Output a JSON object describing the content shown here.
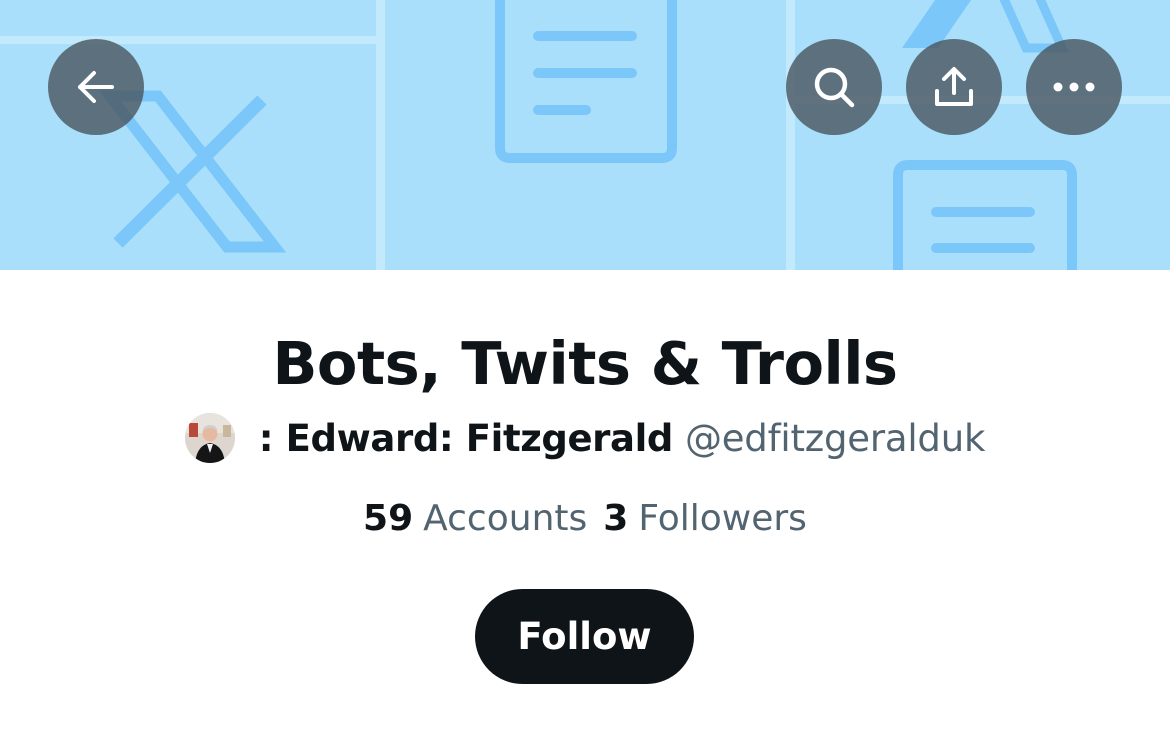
{
  "header": {
    "back_icon": "arrow-left-icon",
    "search_icon": "search-icon",
    "share_icon": "share-upload-icon",
    "more_icon": "more-horizontal-icon"
  },
  "banner": {
    "background_color": "#a9dffa",
    "accent_color": "#7cc7f9",
    "icons": [
      "x-logo-icon",
      "document-icon"
    ]
  },
  "list": {
    "title": "Bots, Twits & Trolls",
    "owner_name": ": Edward: Fitzgerald",
    "owner_handle": "@edfitzgeralduk",
    "accounts_count": "59",
    "accounts_label": "Accounts",
    "followers_count": "3",
    "followers_label": "Followers",
    "follow_label": "Follow"
  },
  "colors": {
    "text_primary": "#0f1419",
    "text_secondary": "#536471",
    "follow_button_bg": "#0f1419",
    "follow_button_text": "#ffffff"
  }
}
